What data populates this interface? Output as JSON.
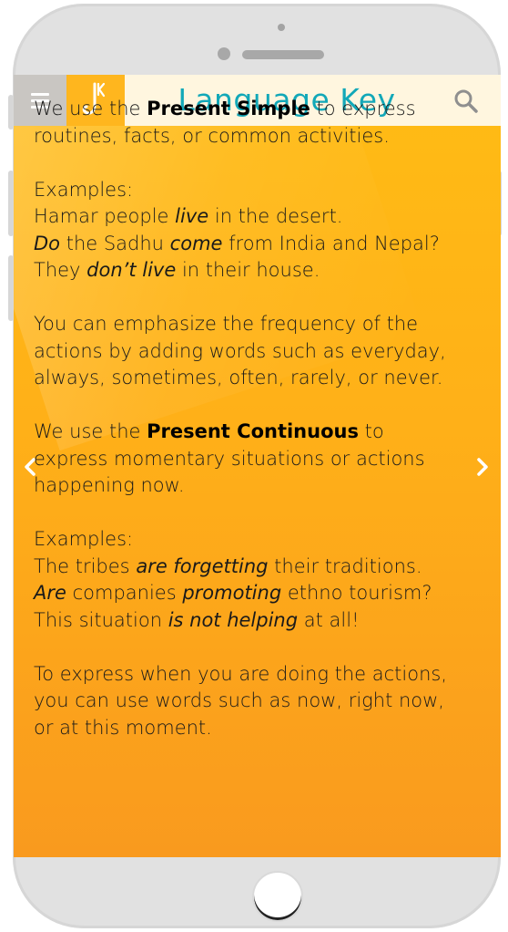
{
  "header": {
    "title": "Language Key",
    "logo_letter": "K",
    "menu_icon": "hamburger-menu-icon",
    "search_icon": "search-icon"
  },
  "colors": {
    "screen_top": "#ffbc14",
    "screen_bottom": "#f99a1e",
    "title": "#12a8b8",
    "header_bg": "#fff6df",
    "menu_bg": "#c9c6c2"
  },
  "content": {
    "p1": {
      "a": "We use the ",
      "bold": "Present Simple",
      "b": " to express routines, facts, or common activities."
    },
    "ex1_label": "Examples:",
    "ex1_l1": {
      "a": "Hamar people ",
      "i": "live",
      "b": " in the desert."
    },
    "ex1_l2": {
      "i1": "Do",
      "a": " the Sadhu ",
      "i2": "come",
      "b": " from India and Nepal?"
    },
    "ex1_l3": {
      "a": "They ",
      "i": "don’t live",
      "b": " in their house."
    },
    "p2": "You can emphasize the frequency of the actions by adding words such as everyday, always, sometimes, often, rarely, or never.",
    "p3": {
      "a": "We use the ",
      "bold": "Present Continuous",
      "b": " to express momentary situations or actions happening now."
    },
    "ex2_label": "Examples:",
    "ex2_l1": {
      "a": "The tribes ",
      "i": "are forgetting",
      "b": " their traditions."
    },
    "ex2_l2": {
      "i1": "Are",
      "a": " companies ",
      "i2": "promoting",
      "b": " ethno tourism?"
    },
    "ex2_l3": {
      "a": "This situation ",
      "i": "is not helping",
      "b": " at all!"
    },
    "p4": "To express when you are doing the actions, you can use words such as now, right now, or at this moment."
  },
  "nav": {
    "prev_icon": "chevron-left-icon",
    "next_icon": "chevron-right-icon"
  }
}
